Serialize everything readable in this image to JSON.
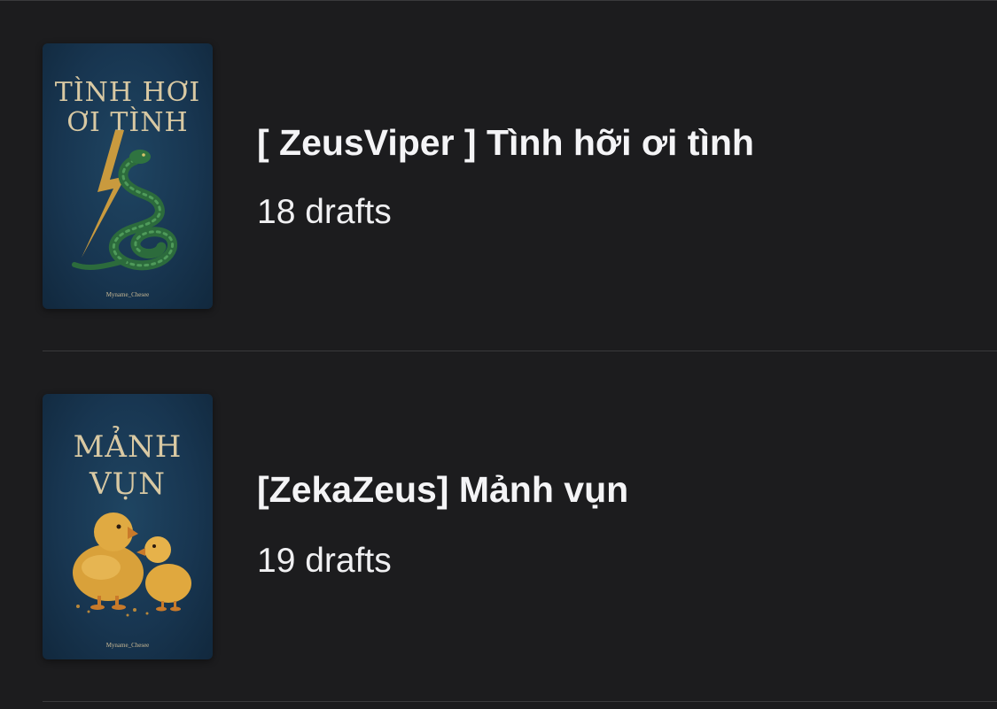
{
  "stories": [
    {
      "title": "[ ZeusViper ] Tình hỡi ơi tình",
      "drafts": "18 drafts",
      "cover": {
        "title_line1": "TÌNH HƠI",
        "title_line2": "ƠI TÌNH",
        "author": "Myname_Chesee",
        "art": "snake-and-lightning"
      }
    },
    {
      "title": "[ZekaZeus] Mảnh vụn",
      "drafts": "19 drafts",
      "cover": {
        "title_line1": "MẢNH",
        "title_line2": "VỤN",
        "author": "Myname_Chesee",
        "art": "two-ducklings"
      }
    }
  ],
  "colors": {
    "background": "#1c1c1e",
    "divider": "#3a3a3c",
    "text": "#f4f4f6",
    "cover_bg": "#183651",
    "cover_text": "#d9c9a3"
  }
}
